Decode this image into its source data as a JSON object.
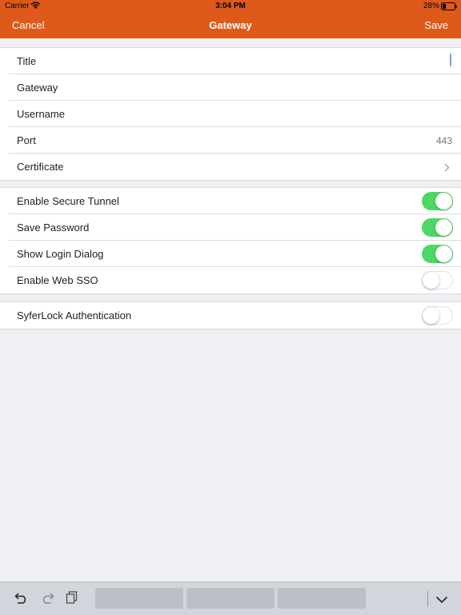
{
  "status_bar": {
    "carrier": "Carrier",
    "time": "3:04 PM",
    "battery": "28%"
  },
  "nav": {
    "cancel": "Cancel",
    "title": "Gateway",
    "save": "Save"
  },
  "form": {
    "title_label": "Title",
    "gateway_label": "Gateway",
    "username_label": "Username",
    "port_label": "Port",
    "port_value": "443",
    "certificate_label": "Certificate"
  },
  "toggles": [
    {
      "label": "Enable Secure Tunnel",
      "on": true
    },
    {
      "label": "Save Password",
      "on": true
    },
    {
      "label": "Show Login Dialog",
      "on": true
    },
    {
      "label": "Enable Web SSO",
      "on": false
    }
  ],
  "syferlock": {
    "label": "SyferLock Authentication",
    "on": false
  },
  "icons": {
    "wifi": "wifi-icon",
    "battery": "battery-icon",
    "chevron": "chevron-right-icon",
    "undo": "undo-icon",
    "redo": "redo-icon",
    "paste": "paste-icon",
    "dismiss": "chevron-down-icon"
  },
  "colors": {
    "accent": "#df5a1a",
    "toggle_on": "#4cd864",
    "background": "#efeff4"
  }
}
